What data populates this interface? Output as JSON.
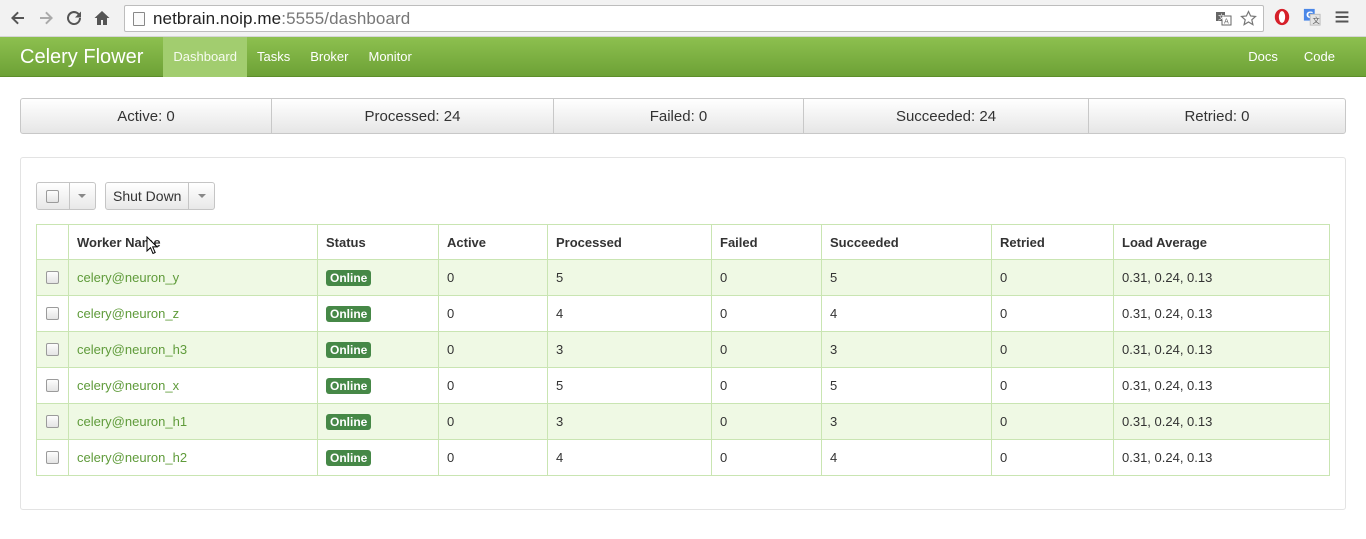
{
  "browser": {
    "url_host": "netbrain.noip.me",
    "url_rest": ":5555/dashboard"
  },
  "navbar": {
    "brand": "Celery Flower",
    "items": [
      {
        "label": "Dashboard",
        "active": true
      },
      {
        "label": "Tasks"
      },
      {
        "label": "Broker"
      },
      {
        "label": "Monitor"
      }
    ],
    "right_items": [
      {
        "label": "Docs"
      },
      {
        "label": "Code"
      }
    ]
  },
  "stats": [
    {
      "label": "Active: 0"
    },
    {
      "label": "Processed: 24"
    },
    {
      "label": "Failed: 0"
    },
    {
      "label": "Succeeded: 24"
    },
    {
      "label": "Retried: 0"
    }
  ],
  "toolbar": {
    "shutdown_label": "Shut Down"
  },
  "table": {
    "headers": [
      "Worker Name",
      "Status",
      "Active",
      "Processed",
      "Failed",
      "Succeeded",
      "Retried",
      "Load Average"
    ],
    "rows": [
      {
        "name": "celery@neuron_y",
        "status": "Online",
        "active": "0",
        "processed": "5",
        "failed": "0",
        "succeeded": "5",
        "retried": "0",
        "load": "0.31, 0.24, 0.13"
      },
      {
        "name": "celery@neuron_z",
        "status": "Online",
        "active": "0",
        "processed": "4",
        "failed": "0",
        "succeeded": "4",
        "retried": "0",
        "load": "0.31, 0.24, 0.13"
      },
      {
        "name": "celery@neuron_h3",
        "status": "Online",
        "active": "0",
        "processed": "3",
        "failed": "0",
        "succeeded": "3",
        "retried": "0",
        "load": "0.31, 0.24, 0.13"
      },
      {
        "name": "celery@neuron_x",
        "status": "Online",
        "active": "0",
        "processed": "5",
        "failed": "0",
        "succeeded": "5",
        "retried": "0",
        "load": "0.31, 0.24, 0.13"
      },
      {
        "name": "celery@neuron_h1",
        "status": "Online",
        "active": "0",
        "processed": "3",
        "failed": "0",
        "succeeded": "3",
        "retried": "0",
        "load": "0.31, 0.24, 0.13"
      },
      {
        "name": "celery@neuron_h2",
        "status": "Online",
        "active": "0",
        "processed": "4",
        "failed": "0",
        "succeeded": "4",
        "retried": "0",
        "load": "0.31, 0.24, 0.13"
      }
    ]
  },
  "colors": {
    "navbar": "#7cb342",
    "badge": "#468847",
    "link": "#5f9b3a",
    "row_stripe": "#eff9e4"
  }
}
